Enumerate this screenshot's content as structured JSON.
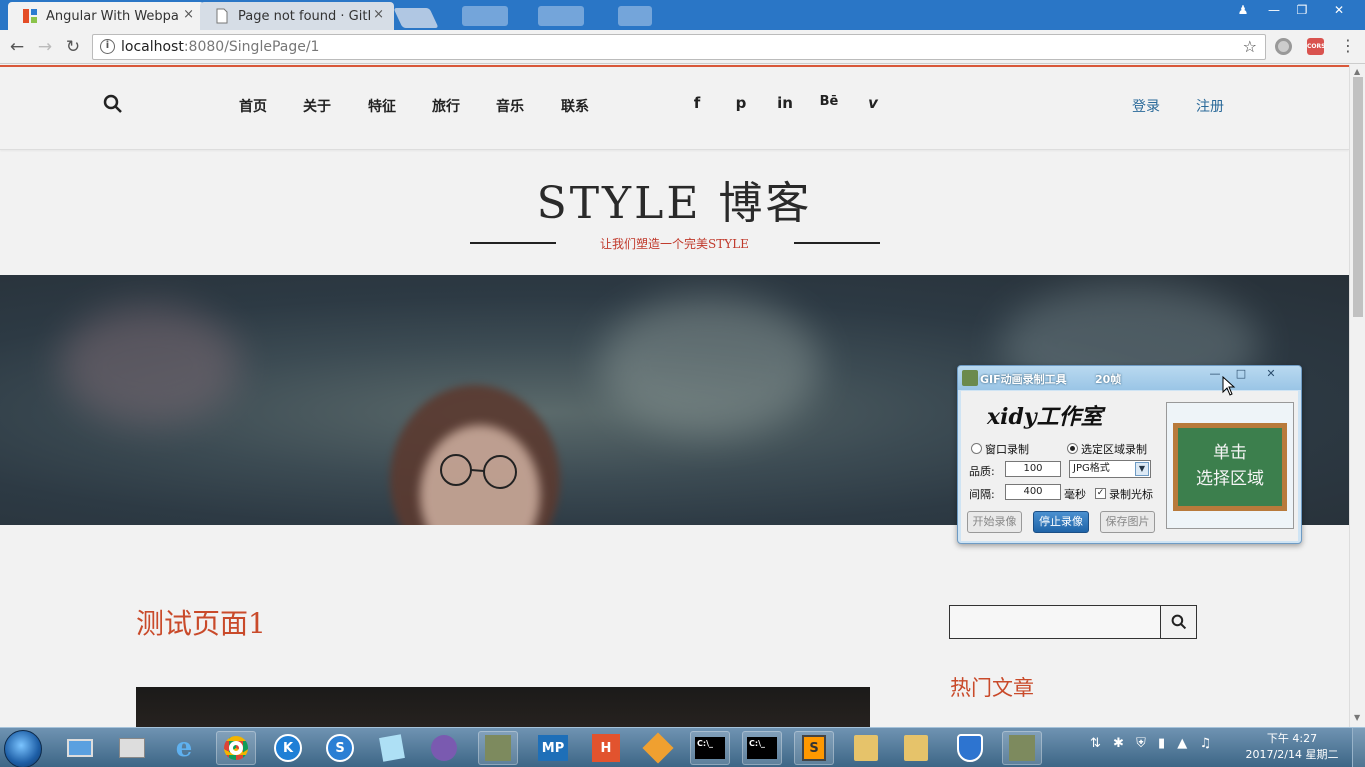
{
  "browser": {
    "tabs": [
      {
        "title": "Angular With Webpack",
        "close": "×",
        "active": true
      },
      {
        "title": "Page not found · GitHub",
        "close": "×",
        "active": false
      }
    ],
    "url_host": "localhost",
    "url_path": ":8080/SinglePage/1",
    "ext_badge": "CORS"
  },
  "site": {
    "nav": [
      "首页",
      "关于",
      "特征",
      "旅行",
      "音乐",
      "联系"
    ],
    "social": [
      "f",
      "p",
      "in",
      "Bē",
      "v"
    ],
    "login": "登录",
    "register": "注册",
    "brand": "STYLE  博客",
    "tagline": "让我们塑造一个完美STYLE",
    "post_title": "测试页面1",
    "sidebar_heading": "热门文章",
    "search_placeholder": ""
  },
  "gif_tool": {
    "title": "GIF动画录制工具",
    "frames": "20帧",
    "logo": "xidy工作室",
    "mode_window": "窗口录制",
    "mode_region": "选定区域录制",
    "quality_label": "品质:",
    "quality_value": "100",
    "format": "JPG格式",
    "interval_label": "间隔:",
    "interval_value": "400",
    "interval_unit": "毫秒",
    "record_cursor": "录制光标",
    "start": "开始录像",
    "stop": "停止录像",
    "save": "保存图片",
    "board_line1": "单击",
    "board_line2": "选择区域"
  },
  "taskbar": {
    "apps": [
      "",
      "",
      "",
      "",
      "K",
      "S",
      "",
      "",
      "",
      "MP",
      "H",
      "",
      "C:\\_",
      "C:\\_",
      "S",
      "",
      "",
      "",
      ""
    ],
    "time": "下午 4:27",
    "date": "2017/2/14 星期二"
  }
}
